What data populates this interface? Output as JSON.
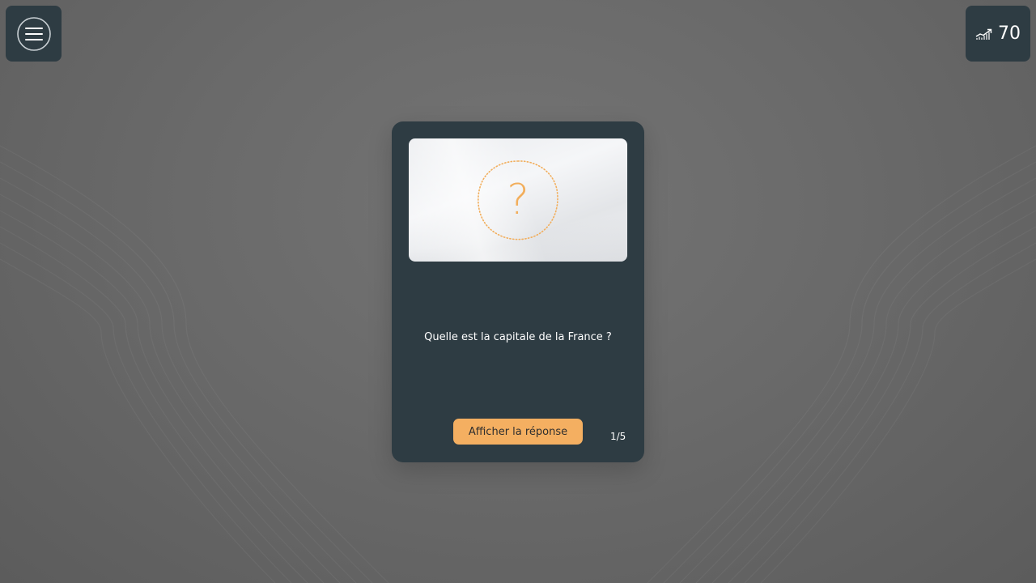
{
  "header": {
    "menu_icon": "hamburger-menu-icon",
    "score_icon": "trending-up-chart-icon",
    "score": "70"
  },
  "card": {
    "image_icon": "question-mark-icon",
    "question_mark": "?",
    "question": "Quelle est la capitale de la France ?",
    "answer_button_label": "Afficher la réponse",
    "progress": "1/5"
  },
  "colors": {
    "panel": "#2e3c43",
    "accent": "#f4af61",
    "background": "#6a6a6a"
  }
}
